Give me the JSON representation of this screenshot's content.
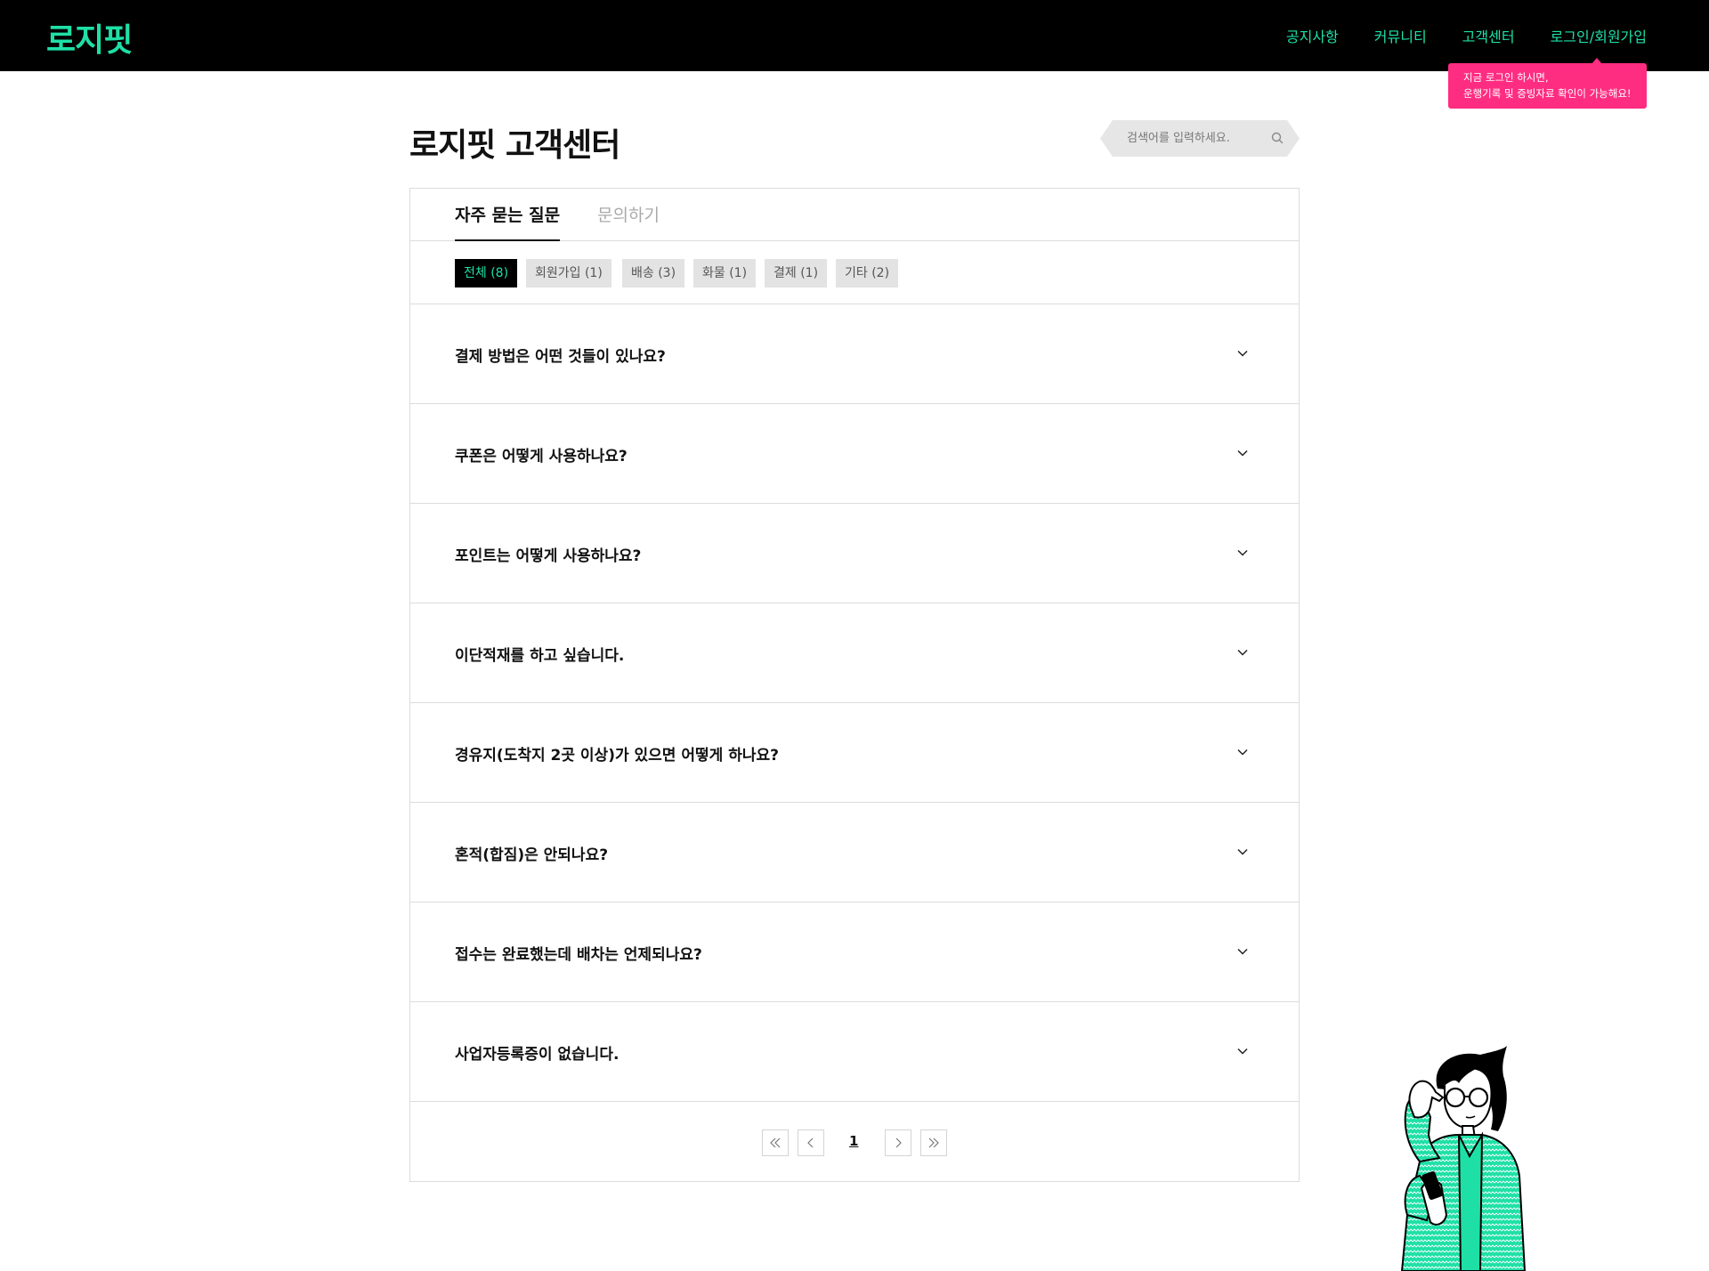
{
  "header": {
    "logo": "로지핏",
    "nav": [
      "공지사항",
      "커뮤니티",
      "고객센터",
      "로그인/회원가입"
    ],
    "tooltip": {
      "line1": "지금 로그인 하시면,",
      "line2": "운행기록 및 증빙자료 확인이 가능해요!"
    }
  },
  "page": {
    "title": "로지핏 고객센터",
    "search": {
      "placeholder": "검색어를 입력하세요."
    }
  },
  "tabs": [
    {
      "label": "자주 묻는 질문",
      "active": true
    },
    {
      "label": "문의하기",
      "active": false
    }
  ],
  "filters": [
    {
      "label": "전체 (8)",
      "active": true
    },
    {
      "label": "회원가입 (1)",
      "active": false
    },
    {
      "label": "배송 (3)",
      "active": false
    },
    {
      "label": "화물 (1)",
      "active": false
    },
    {
      "label": "결제 (1)",
      "active": false
    },
    {
      "label": "기타 (2)",
      "active": false
    }
  ],
  "faqs": [
    "결제 방법은 어떤 것들이 있나요?",
    "쿠폰은 어떻게 사용하나요?",
    "포인트는 어떻게 사용하나요?",
    "이단적재를 하고 싶습니다.",
    "경유지(도착지 2곳 이상)가 있으면 어떻게 하나요?",
    "혼적(합짐)은 안되나요?",
    "접수는 완료했는데 배차는 언제되나요?",
    "사업자등록증이 없습니다."
  ],
  "pagination": {
    "current": "1"
  },
  "colors": {
    "accent": "#1ee0a6",
    "tooltip": "#ff2d82",
    "header_bg": "#000000"
  }
}
